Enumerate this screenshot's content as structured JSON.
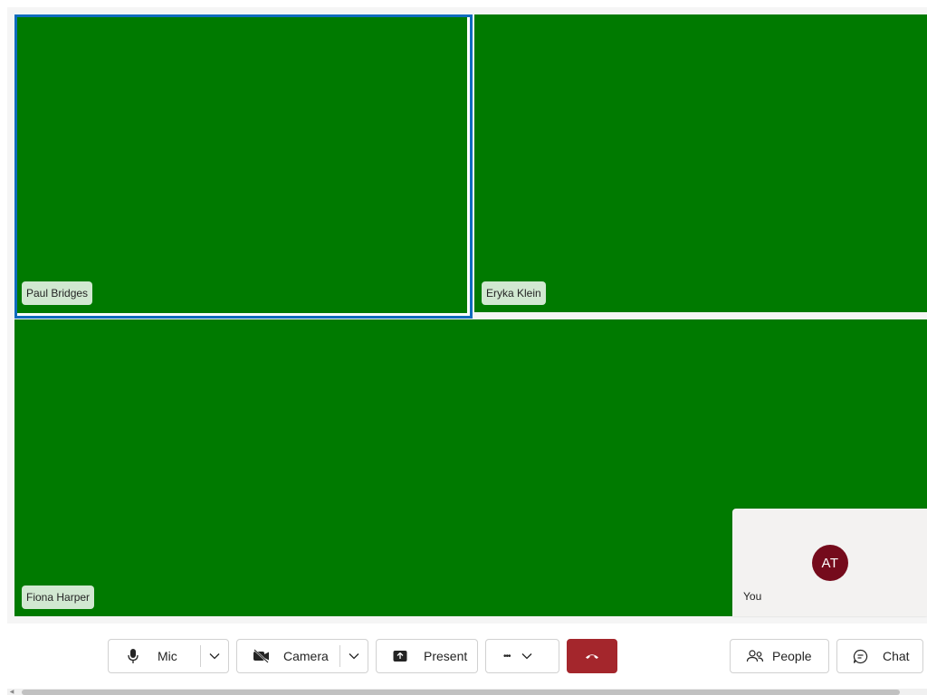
{
  "participants": [
    {
      "name": "Paul Bridges",
      "active_speaker": true
    },
    {
      "name": "Eryka Klein"
    },
    {
      "name": "Fiona Harper"
    }
  ],
  "self_view": {
    "initials": "AT",
    "label": "You"
  },
  "toolbar": {
    "mic_label": "Mic",
    "camera_label": "Camera",
    "present_label": "Present",
    "more_label": "•••",
    "people_label": "People",
    "chat_label": "Chat"
  },
  "colors": {
    "video_bg": "#007a00",
    "active_ring": "#0f6cbd",
    "leave": "#a4262c",
    "avatar": "#750b1c"
  }
}
